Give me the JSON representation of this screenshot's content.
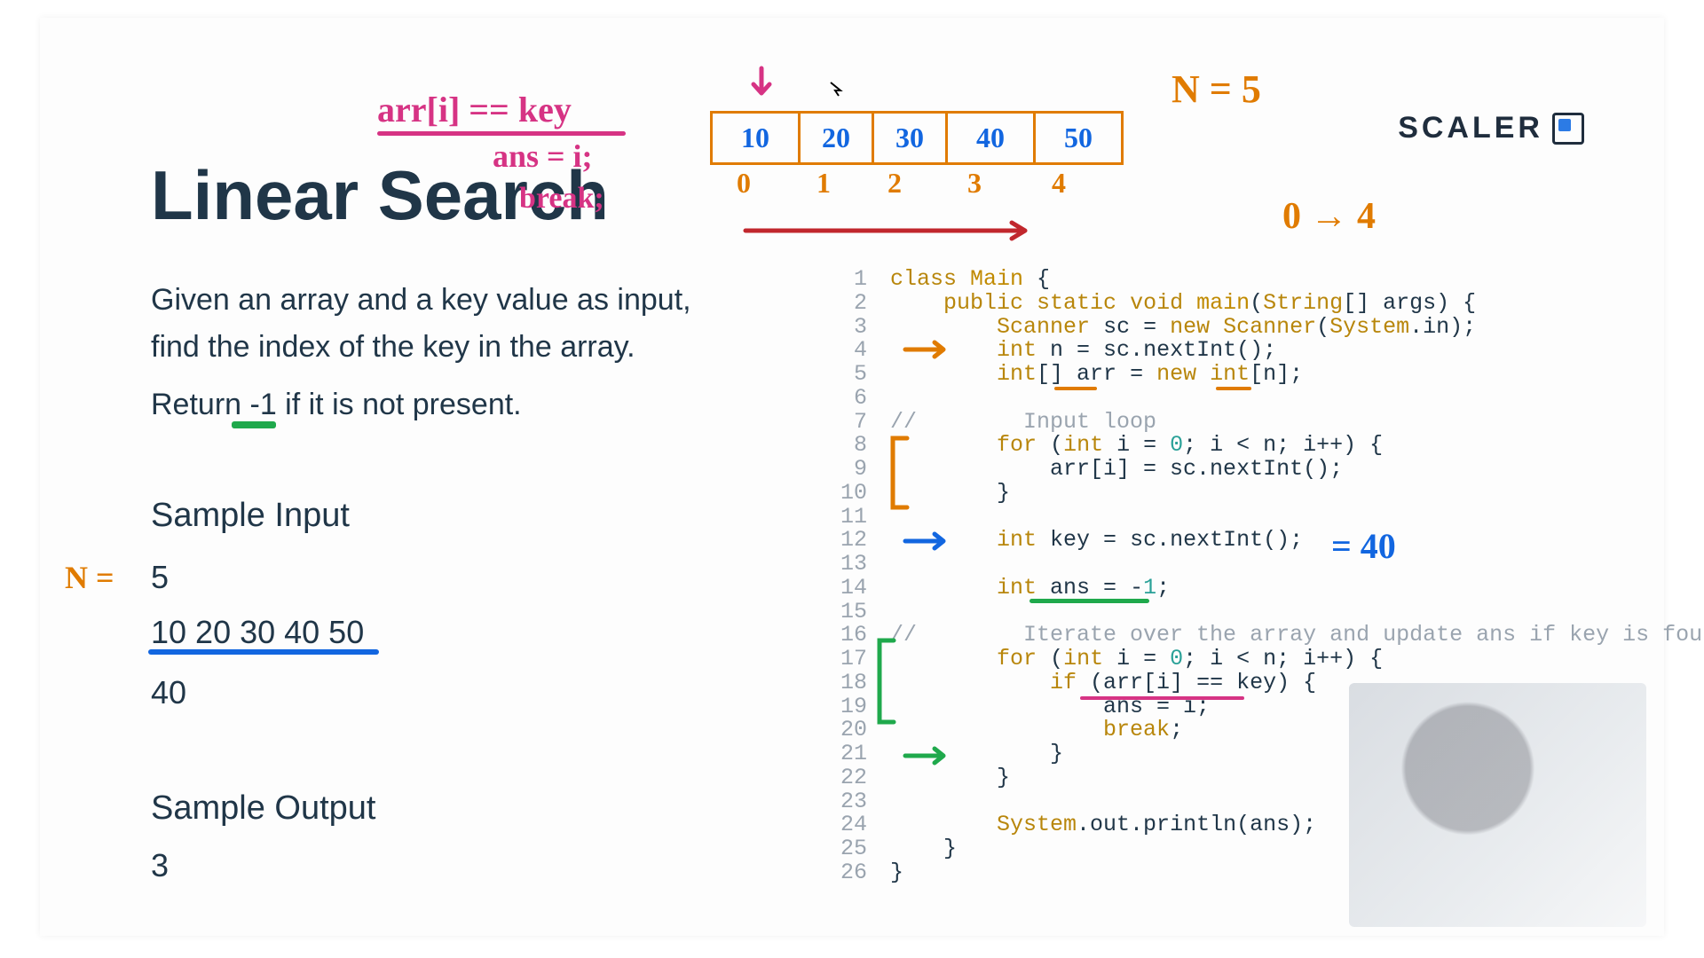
{
  "logo": {
    "text": "SCALER"
  },
  "title": "Linear Search",
  "problem_line1": "Given an array and a key value as input, find the index of the key in the array.",
  "problem_line2": "Return -1  if it is not present.",
  "sample_input_heading": "Sample Input",
  "sample_output_heading": "Sample Output",
  "sample_input": {
    "n": "5",
    "array": "10 20 30 40 50",
    "key": "40"
  },
  "sample_output": "3",
  "annotations": {
    "cond": "arr[i] == key",
    "assign": "ans = i;",
    "brk": "break;",
    "n_label": "N =",
    "n_eq_5": "N = 5",
    "range": "0 → 4",
    "key_eq": "= 40"
  },
  "array_cells": [
    "10",
    "20",
    "30",
    "40",
    "50"
  ],
  "array_indices": [
    "0",
    "1",
    "2",
    "3",
    "4"
  ],
  "code": [
    {
      "n": "1",
      "t": "class Main {",
      "cls": [
        "kw",
        "cls"
      ]
    },
    {
      "n": "2",
      "t": "    public static void main(String[] args) {"
    },
    {
      "n": "3",
      "t": "        Scanner sc = new Scanner(System.in);"
    },
    {
      "n": "4",
      "t": "        int n = sc.nextInt();"
    },
    {
      "n": "5",
      "t": "        int[] arr = new int[n];"
    },
    {
      "n": "6",
      "t": ""
    },
    {
      "n": "7",
      "t": "//        Input loop"
    },
    {
      "n": "8",
      "t": "        for (int i = 0; i < n; i++) {"
    },
    {
      "n": "9",
      "t": "            arr[i] = sc.nextInt();"
    },
    {
      "n": "10",
      "t": "        }"
    },
    {
      "n": "11",
      "t": ""
    },
    {
      "n": "12",
      "t": "        int key = sc.nextInt();"
    },
    {
      "n": "13",
      "t": ""
    },
    {
      "n": "14",
      "t": "        int ans = -1;"
    },
    {
      "n": "15",
      "t": ""
    },
    {
      "n": "16",
      "t": "//        Iterate over the array and update ans if key is found"
    },
    {
      "n": "17",
      "t": "        for (int i = 0; i < n; i++) {"
    },
    {
      "n": "18",
      "t": "            if (arr[i] == key) {"
    },
    {
      "n": "19",
      "t": "                ans = i;"
    },
    {
      "n": "20",
      "t": "                break;"
    },
    {
      "n": "21",
      "t": "            }"
    },
    {
      "n": "22",
      "t": "        }"
    },
    {
      "n": "23",
      "t": ""
    },
    {
      "n": "24",
      "t": "        System.out.println(ans);"
    },
    {
      "n": "25",
      "t": "    }"
    },
    {
      "n": "26",
      "t": "}"
    }
  ]
}
